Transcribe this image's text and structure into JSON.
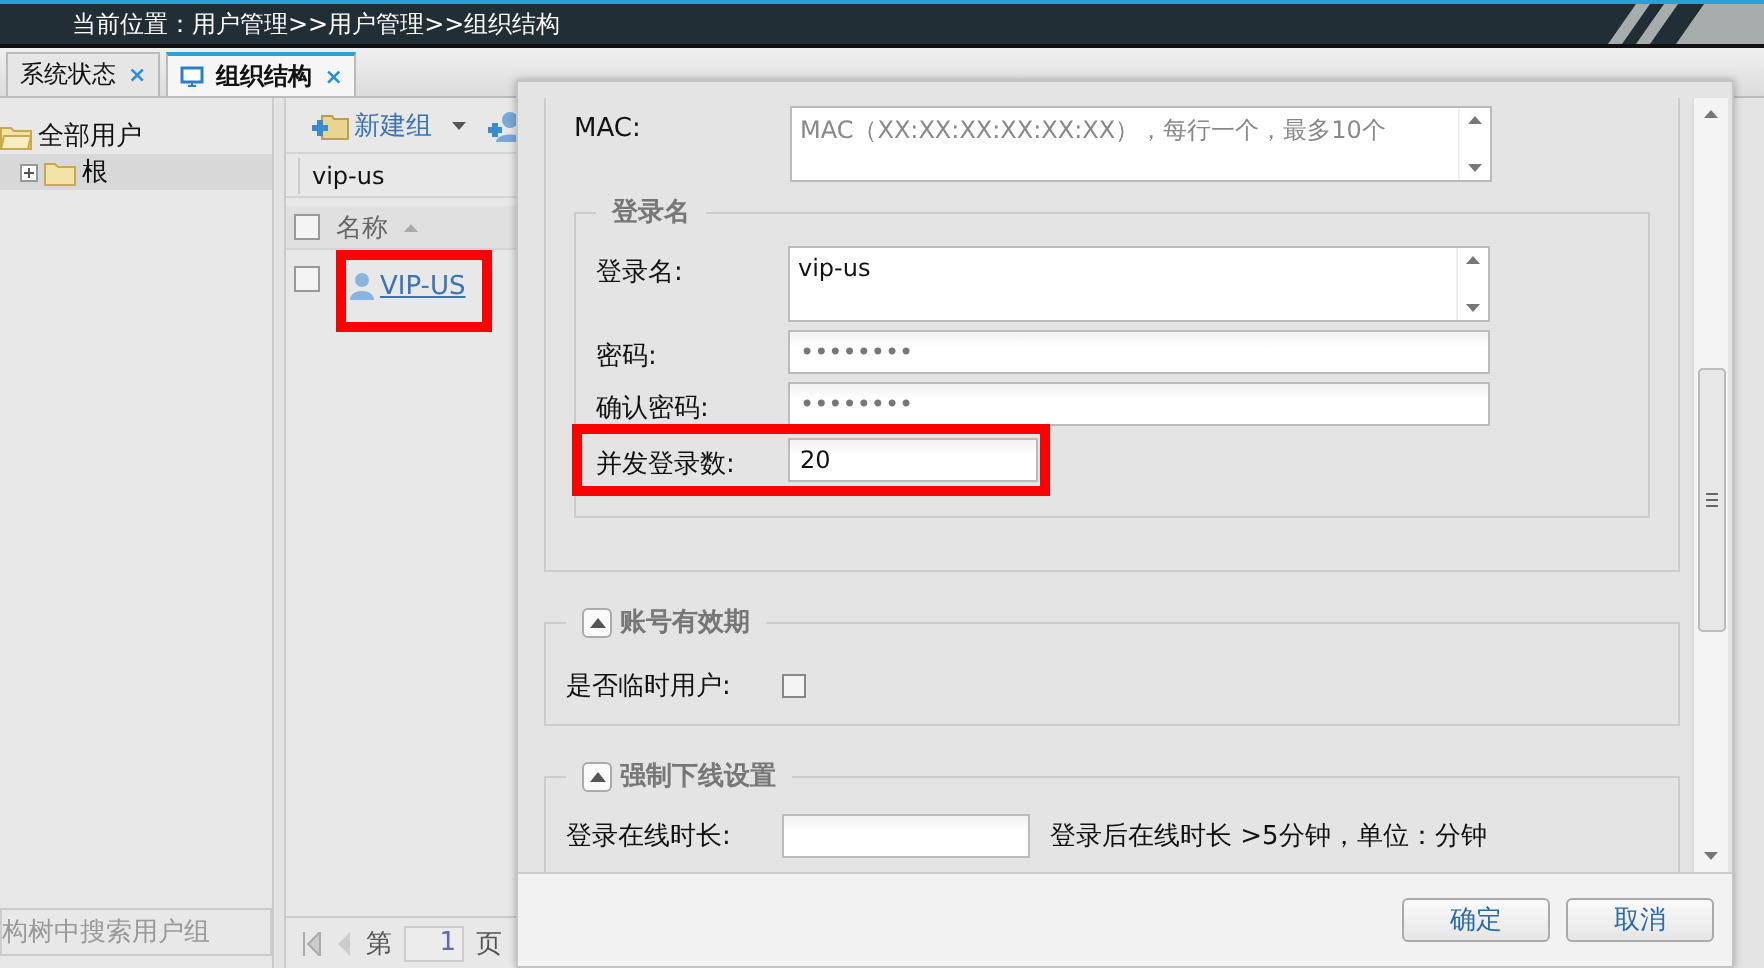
{
  "header": {
    "breadcrumb": "当前位置：用户管理>>用户管理>>组织结构"
  },
  "tabs": [
    {
      "label": "系统状态",
      "selected": false,
      "close": "×"
    },
    {
      "label": "组织结构",
      "selected": true,
      "close": "×"
    }
  ],
  "tree": {
    "items": [
      {
        "label": "全部用户",
        "expanded": true,
        "children": [
          {
            "label": "根",
            "expanded": false,
            "selected": true
          }
        ]
      }
    ],
    "search_placeholder": "构树中搜索用户组"
  },
  "list": {
    "toolbar": [
      {
        "label": "新建组"
      }
    ],
    "filter_value": "vip-us",
    "select_all": {
      "checked": false
    },
    "column": "名称",
    "rows": [
      {
        "name": "VIP-US",
        "checked": false,
        "highlighted": true
      }
    ],
    "pager": {
      "prefix": "第",
      "page": "1",
      "suffix": "页"
    }
  },
  "dialog": {
    "mac": {
      "label": "MAC:",
      "placeholder": "MAC（XX:XX:XX:XX:XX:XX），每行一个，最多10个"
    },
    "login": {
      "legend": "登录名",
      "fields": [
        {
          "kind": "textarea",
          "label": "登录名:",
          "value": "vip-us"
        },
        {
          "kind": "text",
          "label": "密码:",
          "value": "••••••••"
        },
        {
          "kind": "text",
          "label": "确认密码:",
          "value": "••••••••"
        },
        {
          "kind": "short",
          "label": "并发登录数:",
          "value": "20",
          "highlighted": true
        }
      ]
    },
    "validity": {
      "legend": "账号有效期",
      "expanded": true,
      "label": "是否临时用户:",
      "checked": false
    },
    "offline": {
      "legend": "强制下线设置",
      "expanded": true,
      "label": "登录在线时长:",
      "hint": "登录后在线时长 >5分钟，单位：分钟"
    },
    "buttons": [
      "确定",
      "取消"
    ]
  }
}
